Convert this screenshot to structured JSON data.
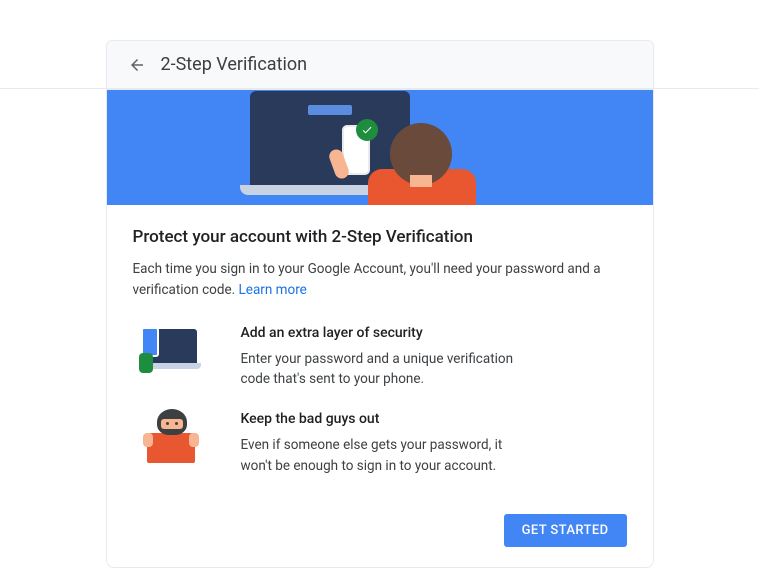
{
  "header": {
    "title": "2-Step Verification"
  },
  "main": {
    "heading": "Protect your account with 2-Step Verification",
    "intro": "Each time you sign in to your Google Account, you'll need your password and a verification code. ",
    "learn_more_label": "Learn more",
    "features": [
      {
        "title": "Add an extra layer of security",
        "desc": "Enter your password and a unique verification code that's sent to your phone."
      },
      {
        "title": "Keep the bad guys out",
        "desc": "Even if someone else gets your password, it won't be enough to sign in to your account."
      }
    ],
    "cta_label": "GET STARTED"
  }
}
